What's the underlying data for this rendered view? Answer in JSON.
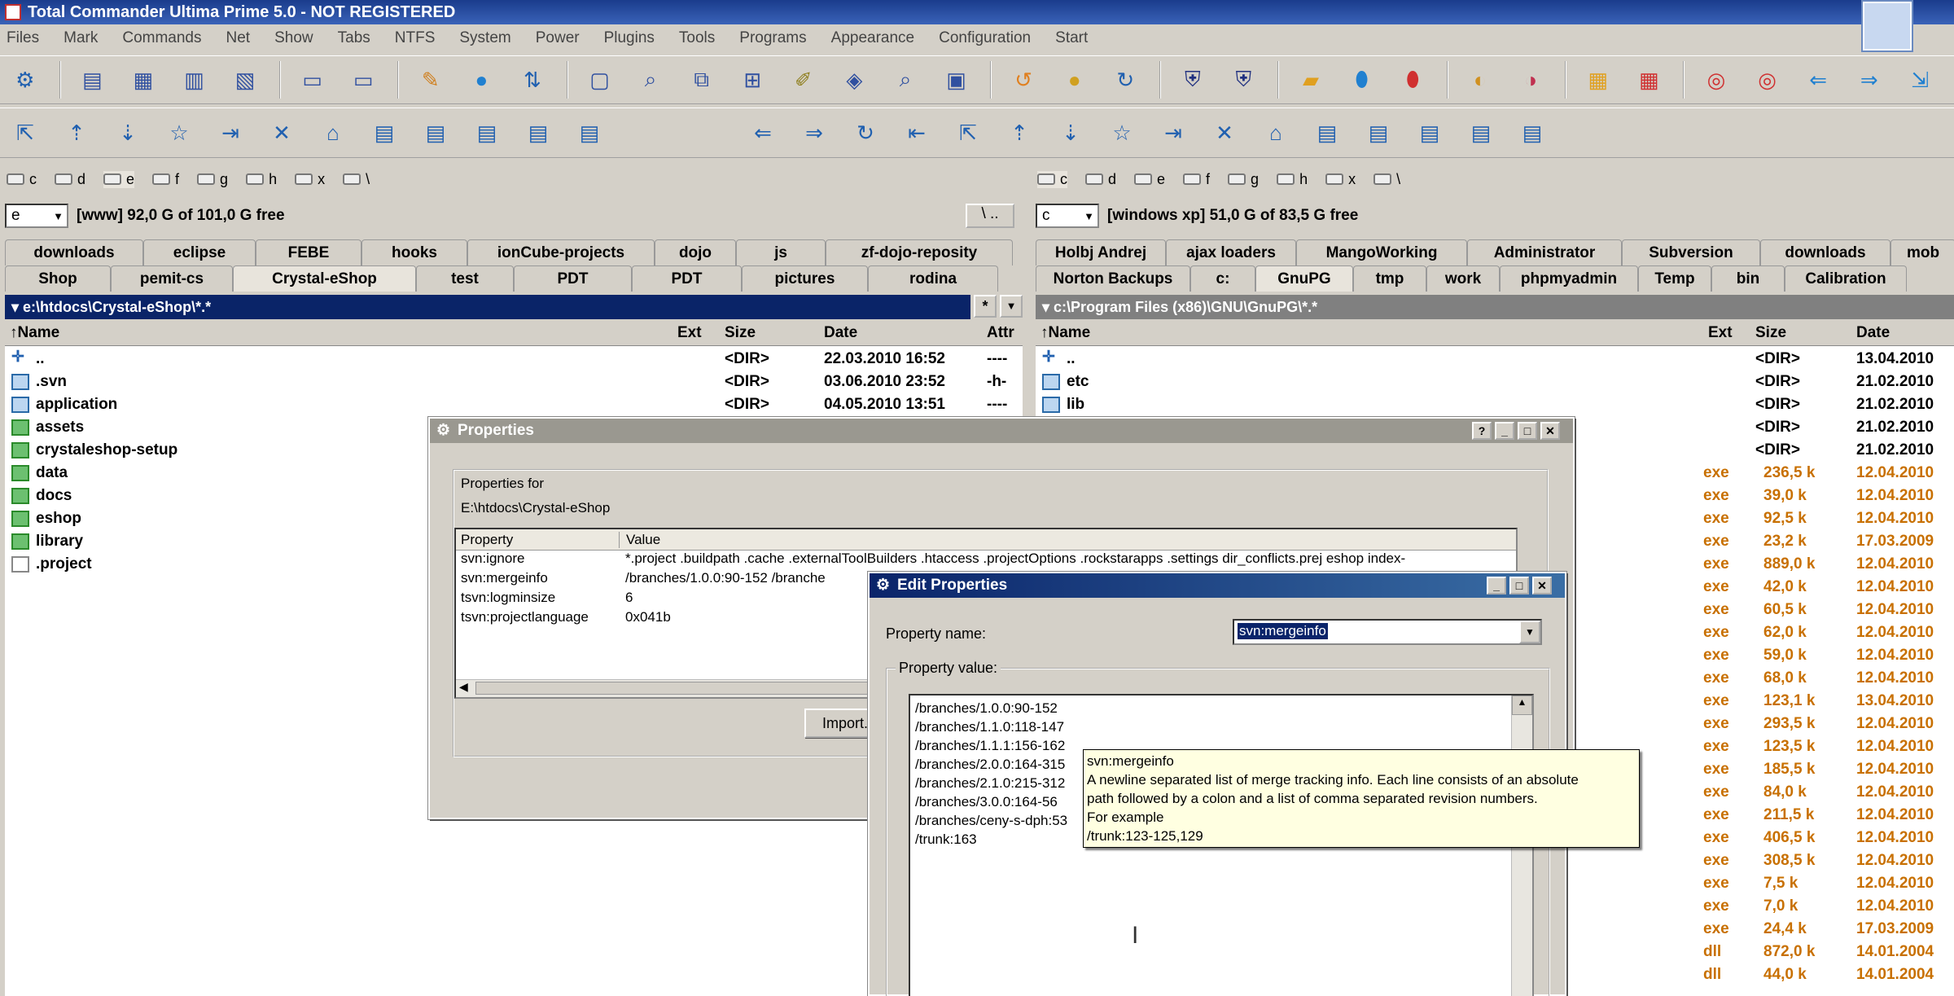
{
  "app": {
    "title": "Total Commander Ultima Prime 5.0 - NOT REGISTERED"
  },
  "menu": [
    "Files",
    "Mark",
    "Commands",
    "Net",
    "Show",
    "Tabs",
    "NTFS",
    "System",
    "Power",
    "Plugins",
    "Tools",
    "Programs",
    "Appearance",
    "Configuration",
    "Start"
  ],
  "drives_left": [
    "c",
    "d",
    "e",
    "f",
    "g",
    "h",
    "x",
    "\\"
  ],
  "drives_right": [
    "c",
    "d",
    "e",
    "f",
    "g",
    "h",
    "x",
    "\\"
  ],
  "left": {
    "drive": "e",
    "free": "[www]  92,0 G of 101,0 G free",
    "tabs_row1": [
      "downloads",
      "eclipse",
      "FEBE",
      "hooks",
      "ionCube-projects",
      "dojo",
      "js",
      "zf-dojo-reposity"
    ],
    "tabs_row2": [
      "Shop",
      "pemit-cs",
      "Crystal-eShop",
      "test",
      "PDT",
      "PDT",
      "pictures",
      "rodina"
    ],
    "path": "e:\\htdocs\\Crystal-eShop\\*.*",
    "cols": {
      "name": "Name",
      "ext": "Ext",
      "size": "Size",
      "date": "Date",
      "attr": "Attr"
    },
    "rows": [
      {
        "name": "..",
        "size": "<DIR>",
        "date": "22.03.2010 16:52",
        "attr": "----"
      },
      {
        "name": ".svn",
        "size": "<DIR>",
        "date": "03.06.2010 23:52",
        "attr": "-h-"
      },
      {
        "name": "application",
        "size": "<DIR>",
        "date": "04.05.2010 13:51",
        "attr": "----"
      },
      {
        "name": "assets",
        "size": "",
        "date": "",
        "attr": ""
      },
      {
        "name": "crystaleshop-setup",
        "size": "",
        "date": "",
        "attr": ""
      },
      {
        "name": "data",
        "size": "",
        "date": "",
        "attr": ""
      },
      {
        "name": "docs",
        "size": "",
        "date": "",
        "attr": ""
      },
      {
        "name": "eshop",
        "size": "",
        "date": "",
        "attr": ""
      },
      {
        "name": "library",
        "size": "",
        "date": "",
        "attr": ""
      },
      {
        "name": ".project",
        "size": "",
        "date": "",
        "attr": ""
      }
    ]
  },
  "right": {
    "drive": "c",
    "free": "[windows xp]  51,0 G of 83,5 G free",
    "tabs_row1": [
      "Holbj Andrej",
      "ajax loaders",
      "MangoWorking",
      "Administrator",
      "Subversion",
      "downloads",
      "mob"
    ],
    "tabs_row2": [
      "Norton Backups",
      "c:",
      "GnuPG",
      "tmp",
      "work",
      "phpmyadmin",
      "Temp",
      "bin",
      "Calibration"
    ],
    "path": "c:\\Program Files (x86)\\GNU\\GnuPG\\*.*",
    "cols": {
      "name": "Name",
      "ext": "Ext",
      "size": "Size",
      "date": "Date"
    },
    "rows": [
      {
        "name": "..",
        "ext": "",
        "size": "<DIR>",
        "date": "13.04.2010"
      },
      {
        "name": "etc",
        "ext": "",
        "size": "<DIR>",
        "date": "21.02.2010"
      },
      {
        "name": "lib",
        "ext": "",
        "size": "<DIR>",
        "date": "21.02.2010"
      },
      {
        "name": "",
        "ext": "",
        "size": "<DIR>",
        "date": "21.02.2010"
      },
      {
        "name": "",
        "ext": "",
        "size": "<DIR>",
        "date": "21.02.2010"
      },
      {
        "name": "",
        "ext": "exe",
        "size": "236,5 k",
        "date": "12.04.2010"
      },
      {
        "name": "",
        "ext": "exe",
        "size": "39,0 k",
        "date": "12.04.2010"
      },
      {
        "name": "",
        "ext": "exe",
        "size": "92,5 k",
        "date": "12.04.2010"
      },
      {
        "name": "",
        "ext": "exe",
        "size": "23,2 k",
        "date": "17.03.2009"
      },
      {
        "name": "",
        "ext": "exe",
        "size": "889,0 k",
        "date": "12.04.2010"
      },
      {
        "name": "",
        "ext": "exe",
        "size": "42,0 k",
        "date": "12.04.2010"
      },
      {
        "name": "",
        "ext": "exe",
        "size": "60,5 k",
        "date": "12.04.2010"
      },
      {
        "name": "",
        "ext": "exe",
        "size": "62,0 k",
        "date": "12.04.2010"
      },
      {
        "name": "",
        "ext": "exe",
        "size": "59,0 k",
        "date": "12.04.2010"
      },
      {
        "name": "",
        "ext": "exe",
        "size": "68,0 k",
        "date": "12.04.2010"
      },
      {
        "name": "",
        "ext": "exe",
        "size": "123,1 k",
        "date": "13.04.2010"
      },
      {
        "name": "",
        "ext": "exe",
        "size": "293,5 k",
        "date": "12.04.2010"
      },
      {
        "name": "",
        "ext": "exe",
        "size": "123,5 k",
        "date": "12.04.2010"
      },
      {
        "name": "",
        "ext": "exe",
        "size": "185,5 k",
        "date": "12.04.2010"
      },
      {
        "name": "",
        "ext": "exe",
        "size": "84,0 k",
        "date": "12.04.2010"
      },
      {
        "name": "",
        "ext": "exe",
        "size": "211,5 k",
        "date": "12.04.2010"
      },
      {
        "name": "",
        "ext": "exe",
        "size": "406,5 k",
        "date": "12.04.2010"
      },
      {
        "name": "",
        "ext": "exe",
        "size": "308,5 k",
        "date": "12.04.2010"
      },
      {
        "name": "",
        "ext": "exe",
        "size": "7,5 k",
        "date": "12.04.2010"
      },
      {
        "name": "",
        "ext": "exe",
        "size": "7,0 k",
        "date": "12.04.2010"
      },
      {
        "name": "",
        "ext": "exe",
        "size": "24,4 k",
        "date": "17.03.2009"
      },
      {
        "name": "",
        "ext": "dll",
        "size": "872,0 k",
        "date": "14.01.2004"
      },
      {
        "name": "",
        "ext": "dll",
        "size": "44,0 k",
        "date": "14.01.2004"
      }
    ]
  },
  "properties": {
    "title": "Properties",
    "for_label": "Properties for",
    "for_path": "E:\\htdocs\\Crystal-eShop",
    "col_property": "Property",
    "col_value": "Value",
    "rows": [
      {
        "p": "svn:ignore",
        "v": "*.project .buildpath .cache .externalToolBuilders .htaccess .projectOptions .rockstarapps .settings dir_conflicts.prej eshop index-"
      },
      {
        "p": "svn:mergeinfo",
        "v": "/branches/1.0.0:90-152 /branche"
      },
      {
        "p": "tsvn:logminsize",
        "v": "6"
      },
      {
        "p": "tsvn:projectlanguage",
        "v": "0x041b"
      }
    ],
    "import_label": "Import..."
  },
  "edit": {
    "title": "Edit Properties",
    "name_label": "Property name:",
    "name_value": "svn:mergeinfo",
    "value_label": "Property value:",
    "lines": [
      "/branches/1.0.0:90-152",
      "/branches/1.1.0:118-147",
      "/branches/1.1.1:156-162",
      "/branches/2.0.0:164-315",
      "/branches/2.1.0:215-312",
      "/branches/3.0.0:164-56",
      "/branches/ceny-s-dph:53",
      "/trunk:163"
    ]
  },
  "tooltip": {
    "title": "svn:mergeinfo",
    "line1": "A newline separated list of merge tracking info. Each line consists of an absolute",
    "line2": "path followed by a colon and a list of comma separated revision numbers.",
    "line3": "For example",
    "line4": "/trunk:123-125,129"
  },
  "colors": {
    "active_path": "#0a2468",
    "inactive_path": "#808080",
    "exe_color": "#c87000"
  }
}
